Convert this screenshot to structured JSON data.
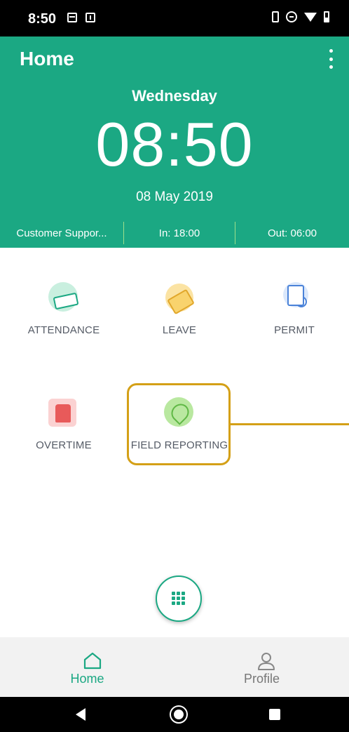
{
  "status_bar": {
    "time": "8:50"
  },
  "header": {
    "title": "Home",
    "day": "Wednesday",
    "clock": "08:50",
    "date": "08 May 2019",
    "shift": "Customer Suppor...",
    "clock_in": "In: 18:00",
    "clock_out": "Out: 06:00"
  },
  "menu": {
    "attendance": "ATTENDANCE",
    "leave": "LEAVE",
    "permit": "PERMIT",
    "overtime": "OVERTIME",
    "field_reporting": "FIELD REPORTING"
  },
  "bottom_nav": {
    "home": "Home",
    "profile": "Profile"
  },
  "colors": {
    "primary": "#1ba883",
    "highlight": "#d4a017",
    "inactive": "#777777"
  },
  "icons": {
    "menu": "overflow-menu-icon",
    "fab": "grid-icon",
    "home": "home-icon",
    "profile": "profile-icon"
  }
}
